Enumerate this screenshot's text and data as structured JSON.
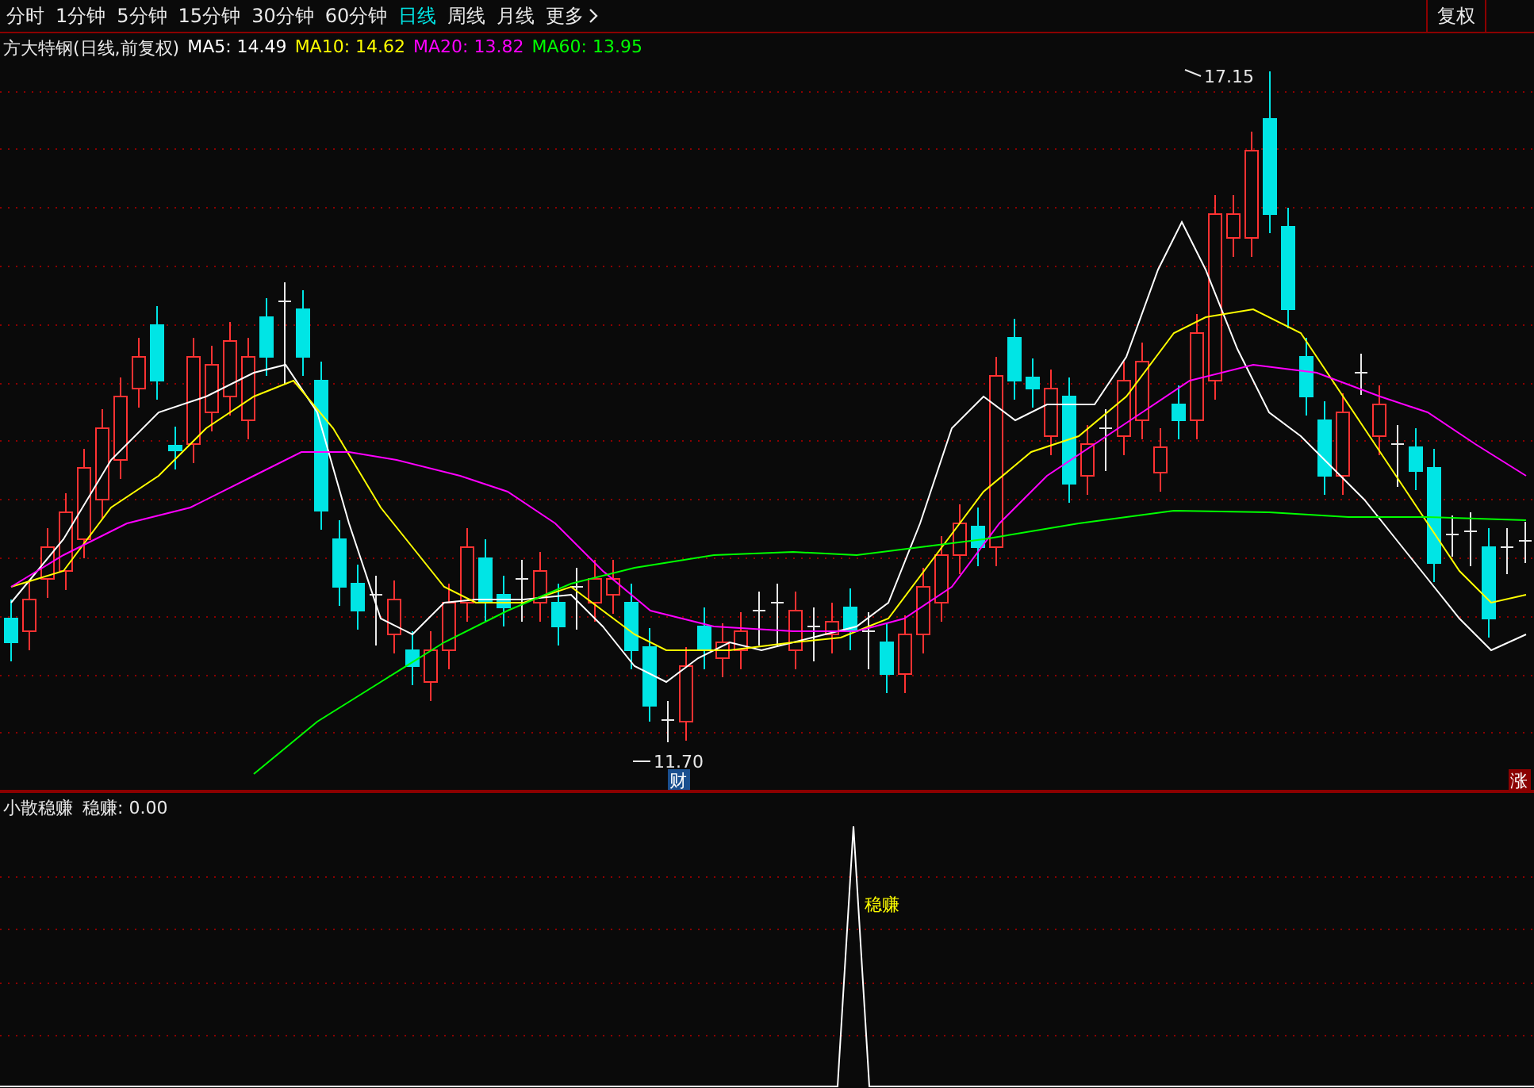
{
  "tabs": [
    {
      "label": "分时",
      "selected": false
    },
    {
      "label": "1分钟",
      "selected": false
    },
    {
      "label": "5分钟",
      "selected": false
    },
    {
      "label": "15分钟",
      "selected": false
    },
    {
      "label": "30分钟",
      "selected": false
    },
    {
      "label": "60分钟",
      "selected": false
    },
    {
      "label": "日线",
      "selected": true
    },
    {
      "label": "周线",
      "selected": false
    },
    {
      "label": "月线",
      "selected": false
    },
    {
      "label": "更多",
      "selected": false
    }
  ],
  "toolbar_buttons": [
    "复权"
  ],
  "legend": {
    "title": "方大特钢(日线,前复权)",
    "averages": [
      {
        "label": "MA5: 14.49",
        "color": "#ffffff"
      },
      {
        "label": "MA10: 14.62",
        "color": "#ffff00"
      },
      {
        "label": "MA20: 13.82",
        "color": "#ff00ff"
      },
      {
        "label": "MA60: 13.95",
        "color": "#00ff00"
      }
    ]
  },
  "price_markers": {
    "high": "17.15",
    "low": "11.70"
  },
  "badges": [
    {
      "text": "财",
      "color": "#1a4f8f"
    },
    {
      "text": "涨",
      "color": "#8b0000"
    }
  ],
  "indicator": {
    "title": "小散稳赚",
    "readout": "稳赚: 0.00",
    "signal_label": "稳赚"
  }
}
